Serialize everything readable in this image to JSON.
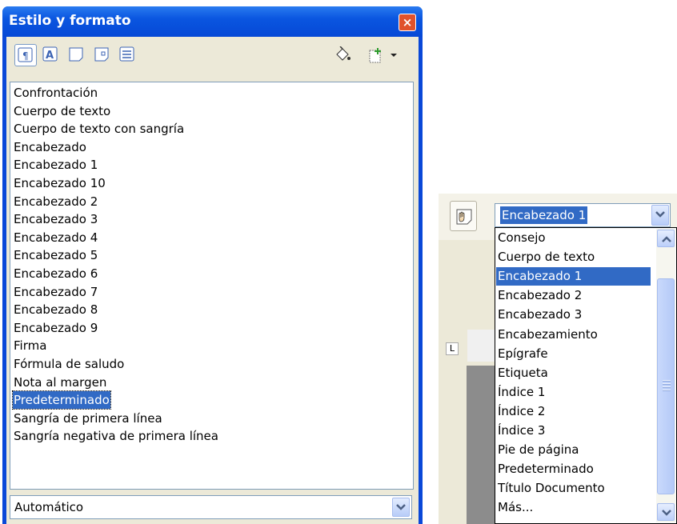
{
  "panel": {
    "title": "Estilo y formato",
    "close_label": "×",
    "toolbar": {
      "icons": [
        "paragraph-styles-icon",
        "character-styles-icon",
        "frame-styles-icon",
        "page-styles-icon",
        "list-styles-icon",
        "fill-format-icon",
        "new-style-icon",
        "dropdown-arrow-icon"
      ],
      "active": "paragraph-styles-icon"
    },
    "styles": [
      "Confrontación",
      "Cuerpo de texto",
      "Cuerpo de texto con sangría",
      "Encabezado",
      "Encabezado 1",
      "Encabezado 10",
      "Encabezado 2",
      "Encabezado 3",
      "Encabezado 4",
      "Encabezado 5",
      "Encabezado 6",
      "Encabezado 7",
      "Encabezado 8",
      "Encabezado 9",
      "Firma",
      "Fórmula de saludo",
      "Nota al margen",
      "Predeterminado",
      "Sangría de primera línea",
      "Sangría negativa de primera línea"
    ],
    "selected_style": "Predeterminado",
    "filter": "Automático"
  },
  "combo": {
    "value": "Encabezado 1",
    "options": [
      "Consejo",
      "Cuerpo de texto",
      "Encabezado 1",
      "Encabezado 2",
      "Encabezado 3",
      "Encabezamiento",
      "Epígrafe",
      "Etiqueta",
      "Índice 1",
      "Índice 2",
      "Índice 3",
      "Pie de página",
      "Predeterminado",
      "Título Documento",
      "Más..."
    ],
    "selected_option": "Encabezado 1",
    "ruler_mark": "L"
  },
  "colors": {
    "titlebar": "#0a56e0",
    "selection": "#316ac5",
    "face": "#ece9d8"
  }
}
